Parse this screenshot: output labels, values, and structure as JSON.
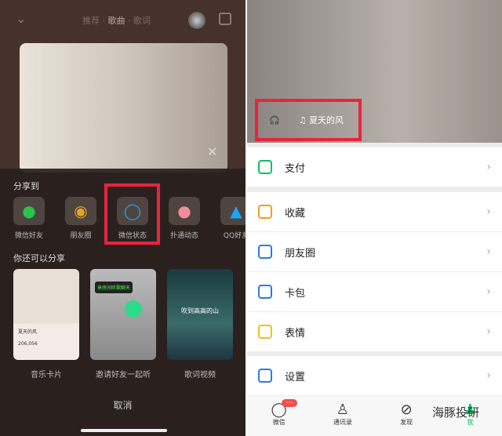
{
  "player": {
    "tabs": [
      "推荐",
      "歌曲",
      "歌词"
    ],
    "active_tab": "歌曲"
  },
  "share": {
    "title": "分享到",
    "targets": [
      {
        "label": "微信好友",
        "icon": "wechat-icon",
        "color": "#2bc34a"
      },
      {
        "label": "朋友圈",
        "icon": "moments-icon",
        "color": "#f0a020"
      },
      {
        "label": "微信状态",
        "icon": "wechat-status-icon",
        "color": "#2d9ee0"
      },
      {
        "label": "扑通动态",
        "icon": "putong-icon",
        "color": "#f28c9c"
      },
      {
        "label": "QQ好友",
        "icon": "qq-icon",
        "color": "#1aa6f2"
      }
    ],
    "more_title": "你还可以分享",
    "cards": [
      {
        "label": "音乐卡片",
        "song": "夏天的风",
        "stat": "206,056"
      },
      {
        "label": "邀请好友一起听",
        "bubble": "来房间听歌聊天"
      },
      {
        "label": "歌词视频",
        "lyric": "吹到高高的山"
      }
    ],
    "cancel": "取消"
  },
  "me": {
    "song_title": "夏天的风",
    "menu": [
      {
        "label": "支付",
        "color": "#07c160"
      },
      {
        "label": "收藏",
        "color": "#f0a020"
      },
      {
        "label": "朋友圈",
        "color": "#2d7be0"
      },
      {
        "label": "卡包",
        "color": "#2d7be0"
      },
      {
        "label": "表情",
        "color": "#f0c020"
      },
      {
        "label": "设置",
        "color": "#2d7be0"
      }
    ],
    "tabbar": [
      {
        "label": "微信",
        "icon": "chat-icon",
        "badge": "···"
      },
      {
        "label": "通讯录",
        "icon": "contacts-icon"
      },
      {
        "label": "发现",
        "icon": "compass-icon"
      },
      {
        "label": "我",
        "icon": "me-icon",
        "active": true
      }
    ],
    "watermark": "海豚投研"
  },
  "accent": "#e8253a"
}
